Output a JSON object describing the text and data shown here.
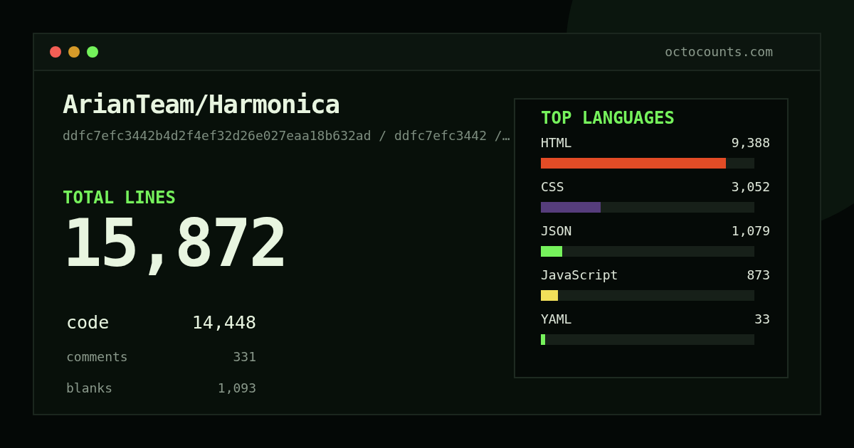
{
  "window": {
    "address": "octocounts.com"
  },
  "repo": {
    "name": "ArianTeam/Harmonica",
    "path": "ddfc7efc3442b4d2f4ef32d26e027eaa18b632ad / ddfc7efc3442 /…"
  },
  "total": {
    "label": "TOTAL LINES",
    "value": "15,872"
  },
  "breakdown": [
    {
      "kind": "primary",
      "label": "code",
      "value": "14,448"
    },
    {
      "kind": "secondary",
      "label": "comments",
      "value": "331"
    },
    {
      "kind": "secondary",
      "label": "blanks",
      "value": "1,093"
    }
  ],
  "languages": {
    "title": "TOP LANGUAGES",
    "items": [
      {
        "name": "HTML",
        "count": "9,388",
        "level": 0.867,
        "color": "#e34c26"
      },
      {
        "name": "CSS",
        "count": "3,052",
        "level": 0.28,
        "color": "#563d7c"
      },
      {
        "name": "JSON",
        "count": "1,079",
        "level": 0.1,
        "color": "#76f25c"
      },
      {
        "name": "JavaScript",
        "count": "873",
        "level": 0.08,
        "color": "#f1e05a"
      },
      {
        "name": "YAML",
        "count": "33",
        "level": 0.02,
        "color": "#76f25c"
      }
    ]
  }
}
